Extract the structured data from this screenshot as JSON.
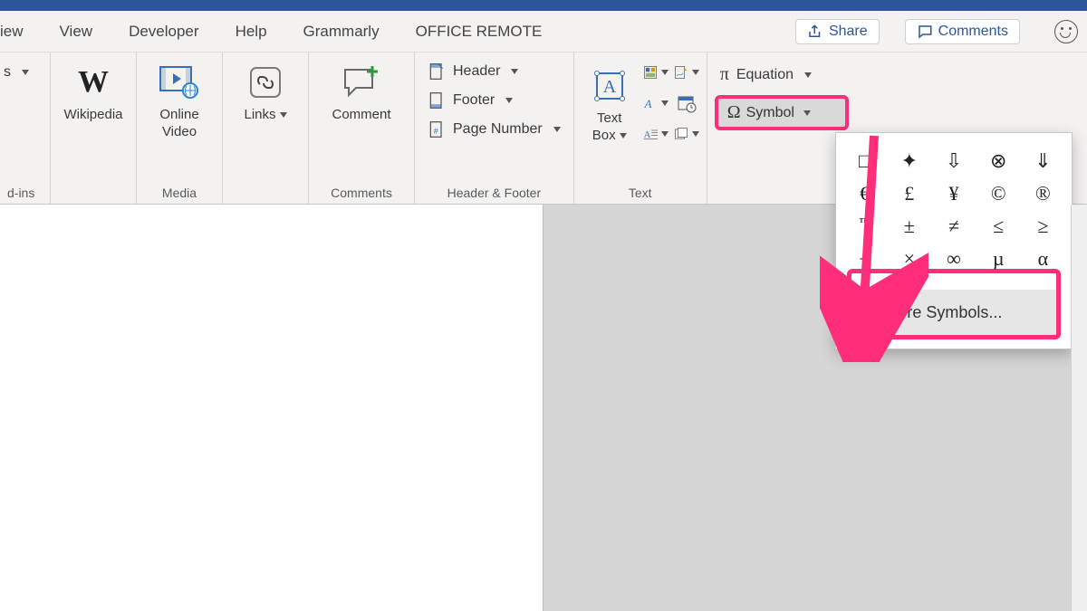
{
  "tabs": {
    "t0": "iew",
    "view": "View",
    "developer": "Developer",
    "help": "Help",
    "grammarly": "Grammarly",
    "office_remote": "OFFICE REMOTE"
  },
  "actions": {
    "share": "Share",
    "comments": "Comments"
  },
  "ribbon": {
    "addins": {
      "label": "d-ins",
      "item0": "s"
    },
    "wikipedia": "Wikipedia",
    "media": {
      "label": "Media",
      "online_video": "Online\nVideo"
    },
    "links": {
      "btn": "Links"
    },
    "comments": {
      "label": "Comments",
      "comment": "Comment"
    },
    "hf": {
      "label": "Header & Footer",
      "header": "Header",
      "footer": "Footer",
      "page_number": "Page Number"
    },
    "text": {
      "label": "Text",
      "text_box": "Text\nBox"
    },
    "symbols": {
      "equation": "Equation",
      "symbol": "Symbol",
      "more": "More Symbols..."
    }
  },
  "symbol_grid": [
    [
      "□",
      "✦",
      "⇩",
      "⊗",
      "⇓"
    ],
    [
      "€",
      "£",
      "¥",
      "©",
      "®"
    ],
    [
      "™",
      "±",
      "≠",
      "≤",
      "≥"
    ],
    [
      "÷",
      "×",
      "∞",
      "µ",
      "α"
    ]
  ]
}
